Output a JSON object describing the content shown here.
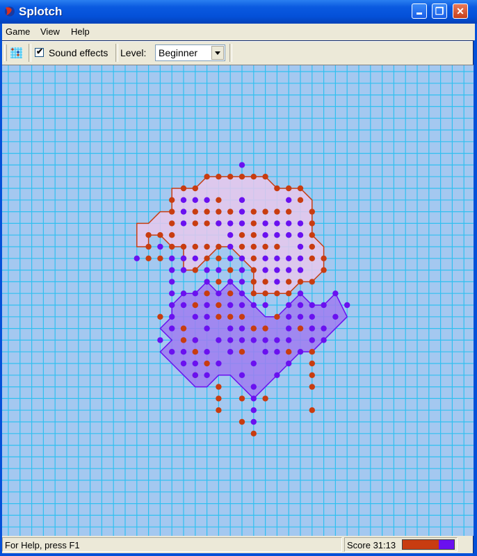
{
  "window": {
    "title": "Splotch",
    "controls": {
      "minimize": "_",
      "restore": "❐",
      "close": "✕"
    }
  },
  "menu": [
    {
      "label": "Game"
    },
    {
      "label": "View"
    },
    {
      "label": "Help"
    }
  ],
  "toolbar": {
    "grid_icon": "grid-icon",
    "sound_effects_label": "Sound effects",
    "sound_effects_checked": true,
    "checkmark": "✔",
    "level_label": "Level:",
    "level_value": "Beginner"
  },
  "status": {
    "help_text": "For Help, press F1",
    "score_text": "Score 31:13",
    "score_red": 31,
    "score_blue": 13
  },
  "colors": {
    "board_bg": "#a4c8f0",
    "grid_line": "#30c0f0",
    "red_player": "#c83c10",
    "blue_player": "#6a10f0",
    "red_region_fill": "#e8c8ec",
    "blue_region_fill": "#a07cf0",
    "red_outline": "#c83c10",
    "blue_outline": "#6a10f0"
  },
  "board": {
    "columns": 40,
    "rows": 40,
    "red_regions": [
      [
        [
          17,
          9
        ],
        [
          22,
          9
        ],
        [
          23,
          10
        ],
        [
          25,
          10
        ],
        [
          26,
          11
        ],
        [
          26,
          14
        ],
        [
          27,
          15
        ],
        [
          27,
          17
        ],
        [
          26,
          18
        ],
        [
          25,
          18
        ],
        [
          24,
          19
        ],
        [
          21,
          19
        ],
        [
          21,
          17
        ],
        [
          20,
          16
        ],
        [
          19,
          15
        ],
        [
          18,
          15
        ],
        [
          17,
          16
        ],
        [
          16,
          17
        ],
        [
          15,
          17
        ],
        [
          15,
          15
        ],
        [
          14,
          15
        ],
        [
          13,
          14
        ],
        [
          12,
          14
        ],
        [
          12,
          15
        ],
        [
          11,
          15
        ],
        [
          11,
          13
        ],
        [
          12,
          13
        ],
        [
          13,
          12
        ],
        [
          14,
          12
        ],
        [
          14,
          10
        ],
        [
          15,
          10
        ],
        [
          16,
          10
        ]
      ]
    ],
    "blue_regions": [
      [
        [
          19,
          18
        ],
        [
          20,
          19
        ],
        [
          21,
          20
        ],
        [
          22,
          21
        ],
        [
          23,
          21
        ],
        [
          24,
          20
        ],
        [
          25,
          19
        ],
        [
          26,
          20
        ],
        [
          27,
          20
        ],
        [
          28,
          19
        ],
        [
          29,
          21
        ],
        [
          26,
          24
        ],
        [
          25,
          24
        ],
        [
          21,
          28
        ],
        [
          20,
          27
        ],
        [
          19,
          26
        ],
        [
          18,
          26
        ],
        [
          17,
          27
        ],
        [
          16,
          27
        ],
        [
          14,
          25
        ],
        [
          13,
          24
        ],
        [
          14,
          23
        ],
        [
          13,
          22
        ],
        [
          14,
          21
        ],
        [
          14,
          20
        ],
        [
          15,
          19
        ],
        [
          16,
          19
        ],
        [
          17,
          18
        ],
        [
          18,
          19
        ]
      ]
    ],
    "red_dots": [
      [
        17,
        9
      ],
      [
        18,
        9
      ],
      [
        19,
        9
      ],
      [
        20,
        9
      ],
      [
        21,
        9
      ],
      [
        22,
        9
      ],
      [
        15,
        10
      ],
      [
        16,
        10
      ],
      [
        23,
        10
      ],
      [
        24,
        10
      ],
      [
        25,
        10
      ],
      [
        14,
        11
      ],
      [
        25,
        11
      ],
      [
        18,
        11
      ],
      [
        14,
        12
      ],
      [
        16,
        12
      ],
      [
        17,
        12
      ],
      [
        18,
        12
      ],
      [
        19,
        12
      ],
      [
        21,
        12
      ],
      [
        22,
        12
      ],
      [
        23,
        12
      ],
      [
        24,
        12
      ],
      [
        26,
        12
      ],
      [
        14,
        13
      ],
      [
        16,
        13
      ],
      [
        17,
        13
      ],
      [
        18,
        13
      ],
      [
        21,
        13
      ],
      [
        26,
        13
      ],
      [
        12,
        14
      ],
      [
        13,
        14
      ],
      [
        14,
        14
      ],
      [
        20,
        14
      ],
      [
        21,
        14
      ],
      [
        26,
        14
      ],
      [
        12,
        15
      ],
      [
        14,
        15
      ],
      [
        15,
        15
      ],
      [
        16,
        15
      ],
      [
        17,
        15
      ],
      [
        18,
        15
      ],
      [
        20,
        15
      ],
      [
        21,
        15
      ],
      [
        22,
        15
      ],
      [
        23,
        15
      ],
      [
        26,
        15
      ],
      [
        12,
        16
      ],
      [
        13,
        16
      ],
      [
        15,
        16
      ],
      [
        17,
        16
      ],
      [
        18,
        16
      ],
      [
        21,
        16
      ],
      [
        26,
        16
      ],
      [
        27,
        16
      ],
      [
        16,
        17
      ],
      [
        19,
        17
      ],
      [
        21,
        17
      ],
      [
        27,
        17
      ],
      [
        18,
        18
      ],
      [
        21,
        18
      ],
      [
        22,
        18
      ],
      [
        24,
        18
      ],
      [
        25,
        18
      ],
      [
        26,
        18
      ],
      [
        21,
        19
      ],
      [
        22,
        19
      ],
      [
        23,
        19
      ],
      [
        24,
        19
      ],
      [
        17,
        19
      ],
      [
        19,
        19
      ],
      [
        18,
        20
      ],
      [
        16,
        20
      ],
      [
        13,
        21
      ],
      [
        18,
        21
      ],
      [
        19,
        21
      ],
      [
        20,
        21
      ],
      [
        23,
        21
      ],
      [
        15,
        22
      ],
      [
        21,
        22
      ],
      [
        22,
        22
      ],
      [
        25,
        22
      ],
      [
        16,
        24
      ],
      [
        20,
        24
      ],
      [
        24,
        24
      ],
      [
        26,
        24
      ],
      [
        17,
        25
      ],
      [
        26,
        25
      ],
      [
        15,
        23
      ],
      [
        16,
        23
      ],
      [
        16,
        26
      ],
      [
        26,
        26
      ],
      [
        18,
        27
      ],
      [
        26,
        27
      ],
      [
        18,
        28
      ],
      [
        20,
        28
      ],
      [
        22,
        28
      ],
      [
        18,
        29
      ],
      [
        26,
        29
      ],
      [
        20,
        30
      ],
      [
        21,
        31
      ]
    ],
    "blue_dots": [
      [
        20,
        8
      ],
      [
        15,
        11
      ],
      [
        16,
        11
      ],
      [
        17,
        11
      ],
      [
        20,
        11
      ],
      [
        24,
        11
      ],
      [
        15,
        12
      ],
      [
        20,
        12
      ],
      [
        15,
        13
      ],
      [
        18,
        13
      ],
      [
        19,
        13
      ],
      [
        20,
        13
      ],
      [
        22,
        13
      ],
      [
        23,
        13
      ],
      [
        24,
        13
      ],
      [
        25,
        13
      ],
      [
        11,
        16
      ],
      [
        13,
        15
      ],
      [
        22,
        14
      ],
      [
        23,
        14
      ],
      [
        24,
        14
      ],
      [
        25,
        14
      ],
      [
        19,
        14
      ],
      [
        19,
        15
      ],
      [
        19,
        16
      ],
      [
        20,
        16
      ],
      [
        22,
        16
      ],
      [
        24,
        16
      ],
      [
        25,
        16
      ],
      [
        14,
        16
      ],
      [
        15,
        16
      ],
      [
        16,
        16
      ],
      [
        19,
        16
      ],
      [
        22,
        17
      ],
      [
        23,
        17
      ],
      [
        24,
        17
      ],
      [
        25,
        17
      ],
      [
        14,
        17
      ],
      [
        15,
        17
      ],
      [
        17,
        17
      ],
      [
        18,
        17
      ],
      [
        20,
        17
      ],
      [
        23,
        16
      ],
      [
        25,
        15
      ],
      [
        14,
        18
      ],
      [
        17,
        18
      ],
      [
        19,
        18
      ],
      [
        20,
        18
      ],
      [
        23,
        18
      ],
      [
        14,
        19
      ],
      [
        15,
        19
      ],
      [
        16,
        19
      ],
      [
        18,
        19
      ],
      [
        20,
        19
      ],
      [
        25,
        19
      ],
      [
        28,
        19
      ],
      [
        14,
        20
      ],
      [
        15,
        20
      ],
      [
        17,
        20
      ],
      [
        19,
        20
      ],
      [
        20,
        20
      ],
      [
        21,
        20
      ],
      [
        22,
        20
      ],
      [
        24,
        20
      ],
      [
        25,
        20
      ],
      [
        26,
        20
      ],
      [
        27,
        20
      ],
      [
        29,
        20
      ],
      [
        14,
        21
      ],
      [
        16,
        21
      ],
      [
        17,
        21
      ],
      [
        24,
        21
      ],
      [
        25,
        21
      ],
      [
        26,
        21
      ],
      [
        28,
        21
      ],
      [
        14,
        22
      ],
      [
        17,
        22
      ],
      [
        19,
        22
      ],
      [
        20,
        22
      ],
      [
        24,
        22
      ],
      [
        26,
        22
      ],
      [
        27,
        22
      ],
      [
        13,
        23
      ],
      [
        16,
        23
      ],
      [
        18,
        23
      ],
      [
        19,
        23
      ],
      [
        20,
        23
      ],
      [
        21,
        23
      ],
      [
        22,
        23
      ],
      [
        23,
        23
      ],
      [
        24,
        23
      ],
      [
        26,
        23
      ],
      [
        27,
        23
      ],
      [
        14,
        24
      ],
      [
        15,
        24
      ],
      [
        17,
        24
      ],
      [
        19,
        24
      ],
      [
        22,
        24
      ],
      [
        23,
        24
      ],
      [
        25,
        24
      ],
      [
        15,
        25
      ],
      [
        16,
        25
      ],
      [
        18,
        25
      ],
      [
        21,
        25
      ],
      [
        24,
        25
      ],
      [
        16,
        26
      ],
      [
        17,
        26
      ],
      [
        20,
        26
      ],
      [
        23,
        26
      ],
      [
        21,
        27
      ],
      [
        21,
        28
      ],
      [
        21,
        29
      ],
      [
        21,
        30
      ]
    ]
  }
}
